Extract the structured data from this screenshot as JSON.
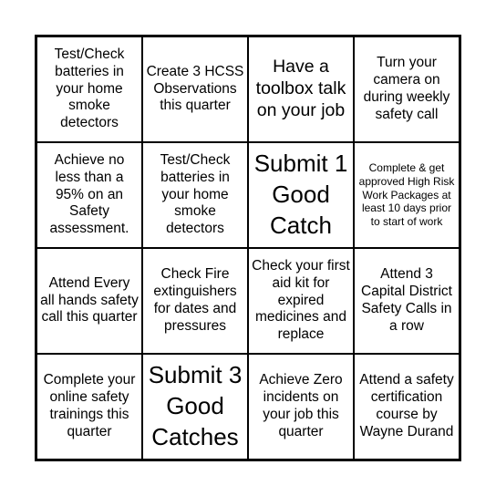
{
  "cells": [
    {
      "text": "Test/Check batteries in your home smoke detectors",
      "size": "m"
    },
    {
      "text": "Create 3 HCSS Observations this quarter",
      "size": "m"
    },
    {
      "text": "Have a toolbox talk on your job",
      "size": "l"
    },
    {
      "text": "Turn your camera on during weekly safety call",
      "size": "m"
    },
    {
      "text": "Achieve no less than a 95% on an Safety assessment.",
      "size": "m"
    },
    {
      "text": "Test/Check batteries in your home smoke detectors",
      "size": "m"
    },
    {
      "text": "Submit 1 Good Catch",
      "size": "xl"
    },
    {
      "text": "Complete & get approved High Risk Work Packages at least 10 days prior to start of work",
      "size": "s"
    },
    {
      "text": "Attend Every all hands safety call this quarter",
      "size": "m"
    },
    {
      "text": "Check Fire extinguishers for dates and pressures",
      "size": "m"
    },
    {
      "text": "Check your first aid kit for expired medicines and replace",
      "size": "m"
    },
    {
      "text": "Attend 3 Capital District Safety Calls in a row",
      "size": "m"
    },
    {
      "text": "Complete your online safety trainings this quarter",
      "size": "m"
    },
    {
      "text": "Submit 3 Good Catches",
      "size": "xl"
    },
    {
      "text": "Achieve Zero incidents on your job this quarter",
      "size": "m"
    },
    {
      "text": "Attend a safety certification course by Wayne Durand",
      "size": "m"
    }
  ]
}
